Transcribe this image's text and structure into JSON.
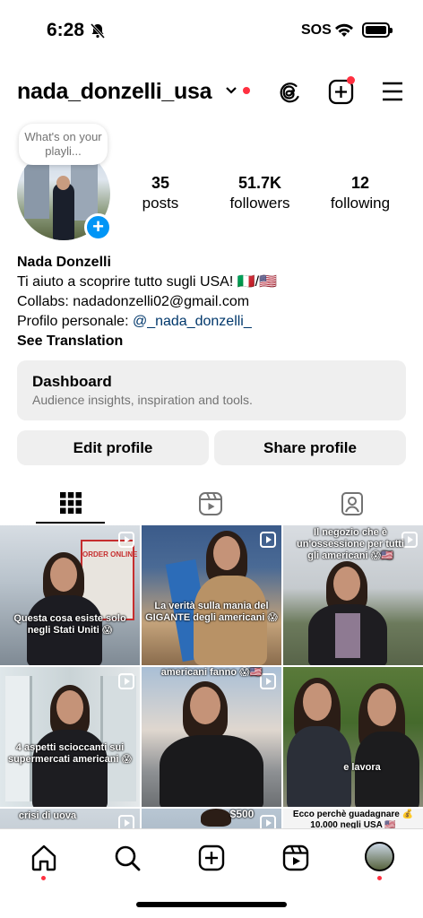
{
  "status_bar": {
    "time": "6:28",
    "sos": "SOS"
  },
  "header": {
    "username": "nada_donzelli_usa"
  },
  "note": {
    "text": "What's on your playli..."
  },
  "stats": {
    "posts": {
      "count": "35",
      "label": "posts"
    },
    "followers": {
      "count": "51.7K",
      "label": "followers"
    },
    "following": {
      "count": "12",
      "label": "following"
    }
  },
  "bio": {
    "name": "Nada Donzelli",
    "line1": "Ti aiuto a scoprire tutto sugli USA! 🇮🇹/🇺🇸",
    "line2": "Collabs: nadadonzelli02@gmail.com",
    "line3_prefix": "Profilo personale: ",
    "line3_link": "@_nada_donzelli_",
    "translate": "See Translation"
  },
  "dashboard": {
    "title": "Dashboard",
    "subtitle": "Audience insights, inspiration and tools."
  },
  "buttons": {
    "edit": "Edit profile",
    "share": "Share profile"
  },
  "grid": {
    "captions": [
      "Questa cosa esiste solo negli Stati Uniti 😱",
      "La verità sulla mania del GIGANTE degli americani 😱",
      "Il negozio che è un'ossessione per tutti gli americani 😱🇺🇸",
      "4 aspetti scioccanti sui supermercati americani 😱",
      "americani fanno 😱🇺🇸",
      "e lavora",
      "crisi di uova",
      "$500",
      "Ecco perchè guadagnare 💰10.000 negli USA 🇺🇸"
    ],
    "store_sign": "ORDER ONLINE"
  },
  "colors": {
    "accent": "#0095f6",
    "notification": "#ff3040",
    "button_bg": "#efefef"
  }
}
